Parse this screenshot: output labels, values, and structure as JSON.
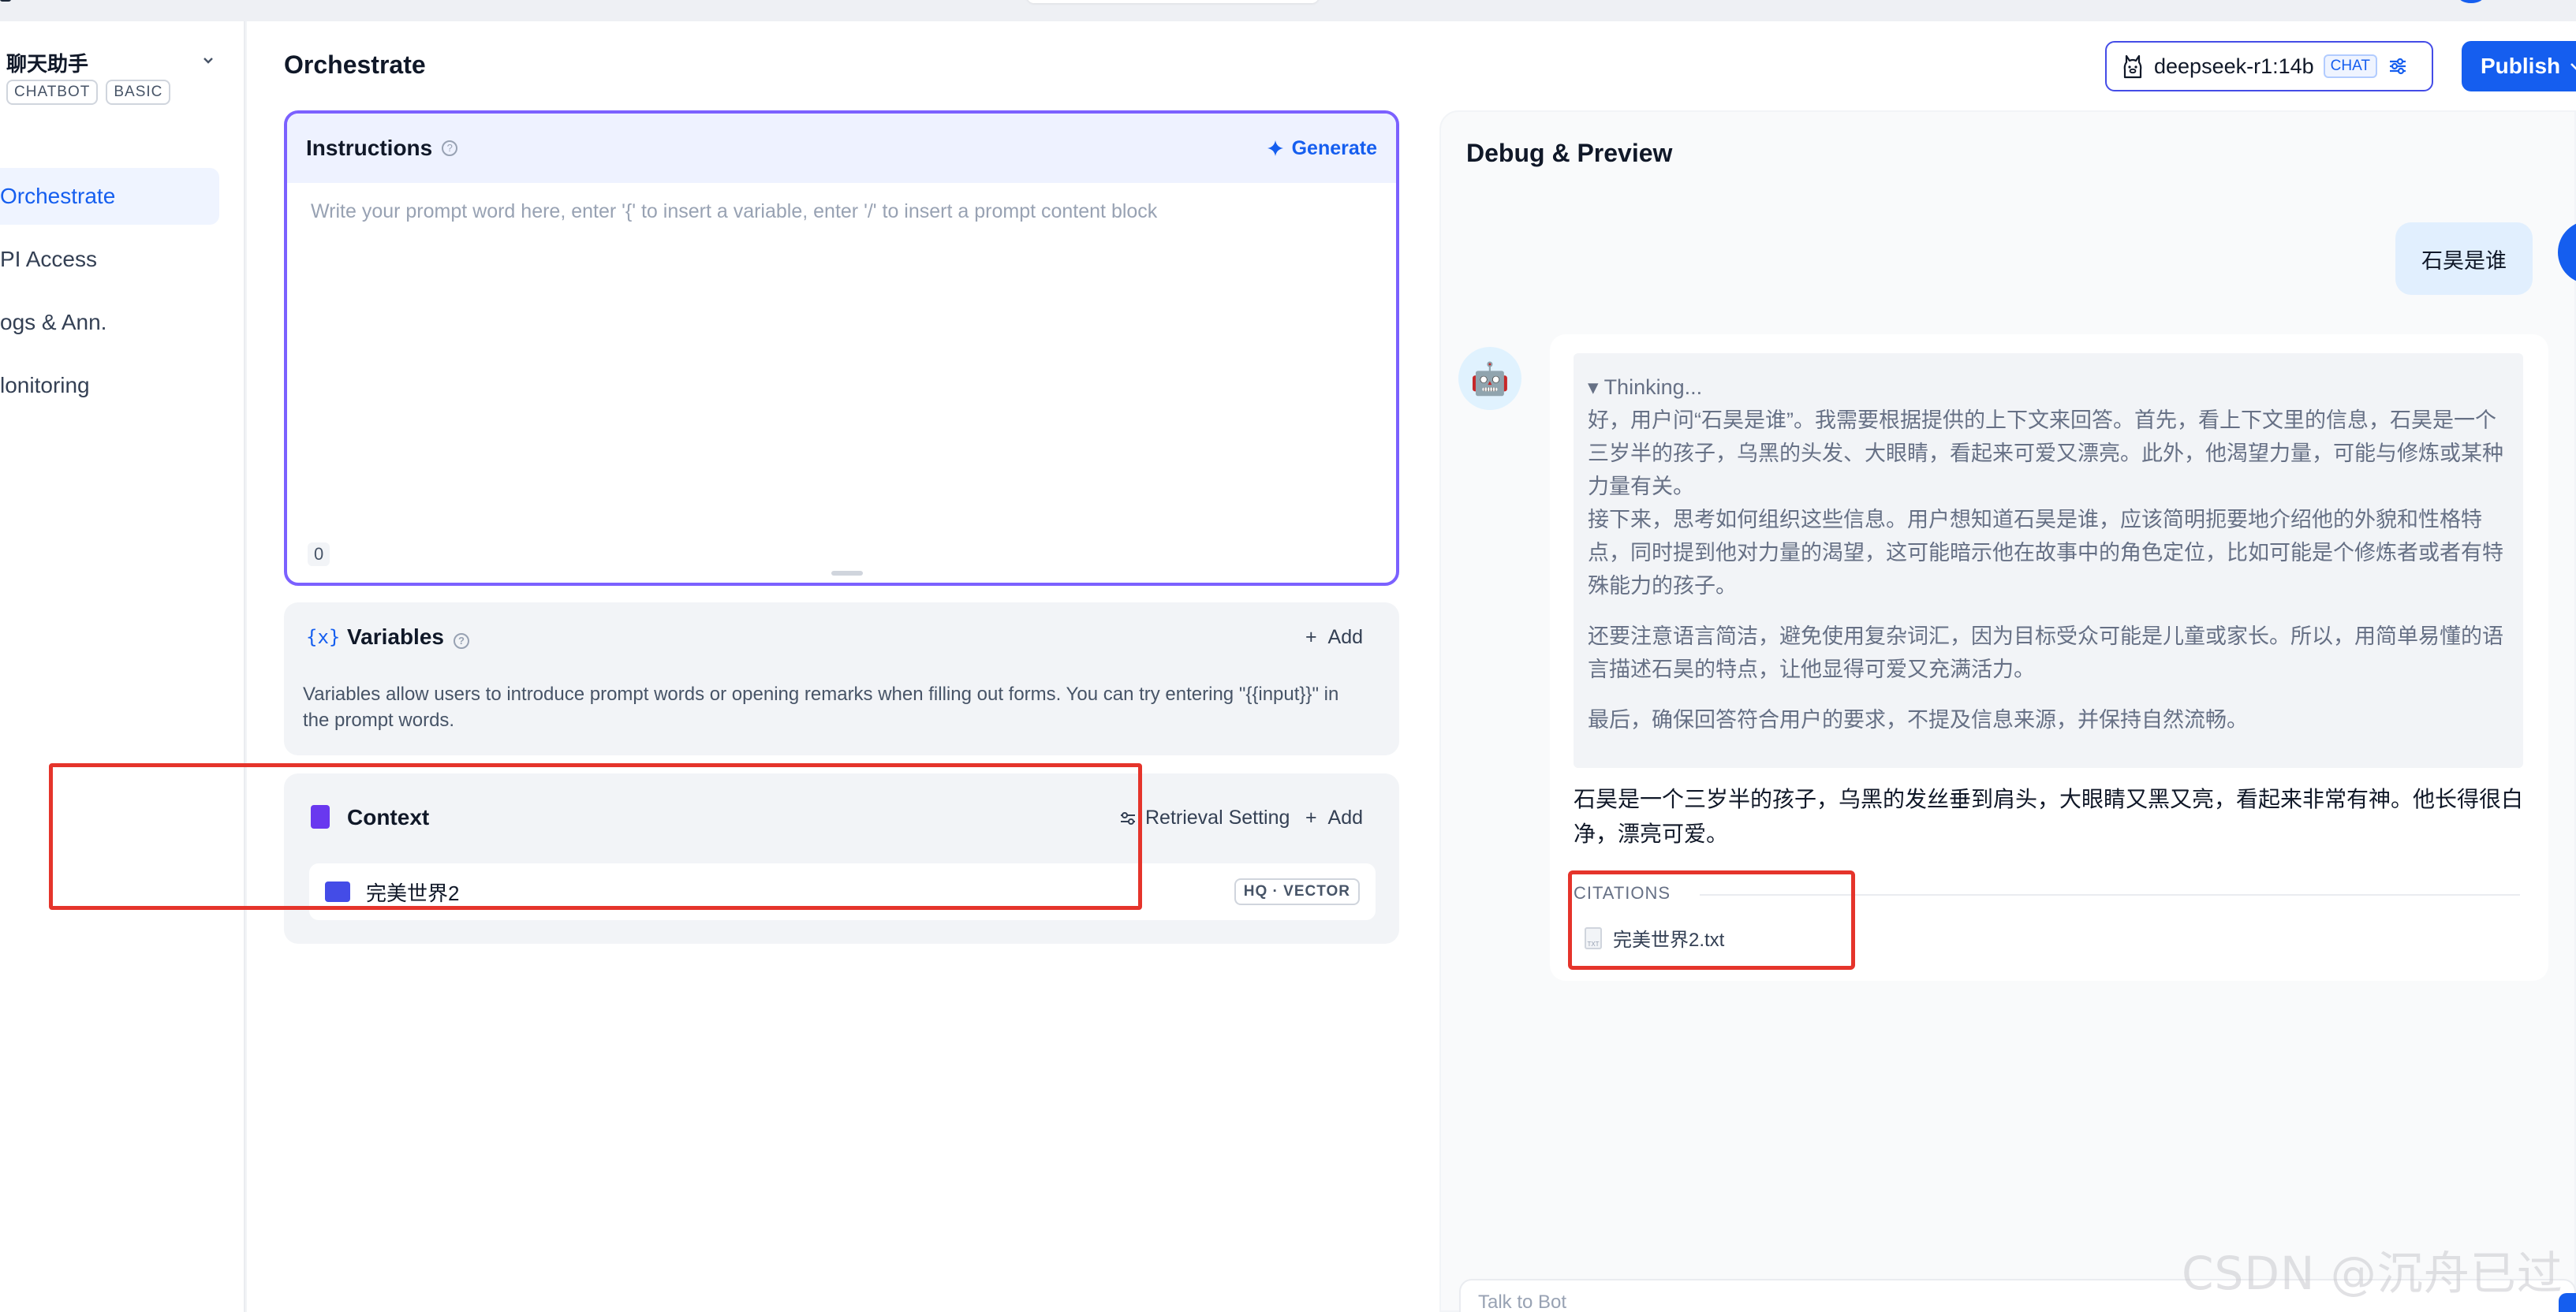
{
  "sidebar": {
    "app_name": "聊天助手",
    "tags": [
      "CHATBOT",
      "BASIC"
    ],
    "nav": [
      {
        "label": "Orchestrate",
        "active": true
      },
      {
        "label": "PI Access",
        "active": false
      },
      {
        "label": "ogs & Ann.",
        "active": false
      },
      {
        "label": "lonitoring",
        "active": false
      }
    ]
  },
  "header": {
    "title": "Orchestrate",
    "model_name": "deepseek-r1:14b",
    "model_mode": "CHAT",
    "publish_label": "Publish"
  },
  "instructions": {
    "title": "Instructions",
    "generate_label": "Generate",
    "placeholder": "Write your prompt word here, enter '{' to insert a variable, enter '/' to insert a prompt content block",
    "char_count": "0"
  },
  "variables": {
    "icon_text": "{x}",
    "title": "Variables",
    "add_label": "Add",
    "description": "Variables allow users to introduce prompt words or opening remarks when filling out forms. You can try entering \"{{input}}\" in the prompt words."
  },
  "context": {
    "title": "Context",
    "retrieval_label": "Retrieval Setting",
    "add_label": "Add",
    "dataset_name": "完美世界2",
    "dataset_tag": "HQ · VECTOR"
  },
  "debug": {
    "title": "Debug & Preview",
    "user_message": "石昊是谁",
    "thinking_toggle": "▾ Thinking...",
    "thinking_paragraphs": [
      "好，用户问“石昊是谁”。我需要根据提供的上下文来回答。首先，看上下文里的信息，石昊是一个三岁半的孩子，乌黑的头发、大眼睛，看起来可爱又漂亮。此外，他渴望力量，可能与修炼或某种力量有关。",
      "接下来，思考如何组织这些信息。用户想知道石昊是谁，应该简明扼要地介绍他的外貌和性格特点，同时提到他对力量的渴望，这可能暗示他在故事中的角色定位，比如可能是个修炼者或者有特殊能力的孩子。",
      "还要注意语言简洁，避免使用复杂词汇，因为目标受众可能是儿童或家长。所以，用简单易懂的语言描述石昊的特点，让他显得可爱又充满活力。",
      "最后，确保回答符合用户的要求，不提及信息来源，并保持自然流畅。"
    ],
    "answer": "石昊是一个三岁半的孩子，乌黑的发丝垂到肩头，大眼睛又黑又亮，看起来非常有神。他长得很白净，漂亮可爱。",
    "citations_label": "CITATIONS",
    "citation_file": "完美世界2.txt",
    "input_placeholder": "Talk to Bot"
  },
  "watermark": "CSDN @沉舟已过",
  "colors": {
    "accent": "#155eef",
    "highlight_box": "#e5342b",
    "instruction_border": "#7b61ff"
  }
}
